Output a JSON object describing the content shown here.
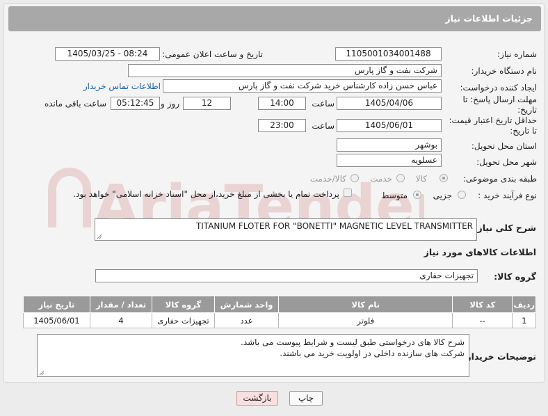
{
  "header": {
    "title": "جزئیات اطلاعات نیاز"
  },
  "watermark": {
    "text": "AriaTender.neT"
  },
  "fields": {
    "need_number_label": "شماره نیاز:",
    "need_number": "1105001034001488",
    "announce_label": "تاریخ و ساعت اعلان عمومی:",
    "announce_value": "1405/03/25 - 08:24",
    "buyer_org_label": "نام دستگاه خریدار:",
    "buyer_org": "شرکت نفت و گاز پارس",
    "creator_label": "ایجاد کننده درخواست:",
    "creator": "عباس حسن زاده کارشناس خرید شرکت نفت و گاز پارس",
    "contact_link": "اطلاعات تماس خریدار",
    "reply_deadline_label": "مهلت ارسال پاسخ: تا تاریخ:",
    "reply_date": "1405/04/06",
    "time_label": "ساعت",
    "reply_time": "14:00",
    "days_value": "12",
    "days_label": "روز و",
    "remaining_time": "05:12:45",
    "remaining_label": "ساعت باقی مانده",
    "price_deadline_label": "حداقل تاریخ اعتبار قیمت: تا تاریخ:",
    "price_date": "1405/06/01",
    "price_time_label": "ساعت",
    "price_time": "23:00",
    "province_label": "استان محل تحویل:",
    "province": "بوشهر",
    "city_label": "شهر محل تحویل:",
    "city": "عسلویه",
    "category_label": "طبقه بندی موضوعی:",
    "category_options": [
      "کالا",
      "خدمت",
      "کالا/خدمت"
    ],
    "process_label": "نوع فرآیند خرید :",
    "process_options": [
      "جزیی",
      "متوسط"
    ],
    "payment_note": "پرداخت تمام یا بخشی از مبلغ خرید،از محل \"اسناد خزانه اسلامی\" خواهد بود."
  },
  "general_desc": {
    "label": "شرح کلی نیاز:",
    "value": "TITANIUM FLOTER FOR \"BONETTI\"  MAGNETIC LEVEL TRANSMITTER"
  },
  "goods_info": {
    "title": "اطلاعات کالاهای مورد نیاز",
    "group_label": "گروه کالا:",
    "group_value": "تجهیزات حفاری"
  },
  "table": {
    "headers": [
      "ردیف",
      "کد کالا",
      "نام کالا",
      "واحد شمارش",
      "گروه کالا",
      "تعداد / مقدار",
      "تاریخ نیاز"
    ],
    "rows": [
      [
        "1",
        "--",
        "فلوتر",
        "عدد",
        "تجهیزات حفاری",
        "4",
        "1405/06/01"
      ]
    ]
  },
  "buyer_notes": {
    "label": "توضیحات خریدار:",
    "line1": "شرح کالا های درخواستی طبق لیست و شرایط پیوست می باشد.",
    "line2": "شرکت های سازنده داخلی در اولویت خرید می باشند."
  },
  "buttons": {
    "print": "چاپ",
    "back": "بازگشت"
  }
}
